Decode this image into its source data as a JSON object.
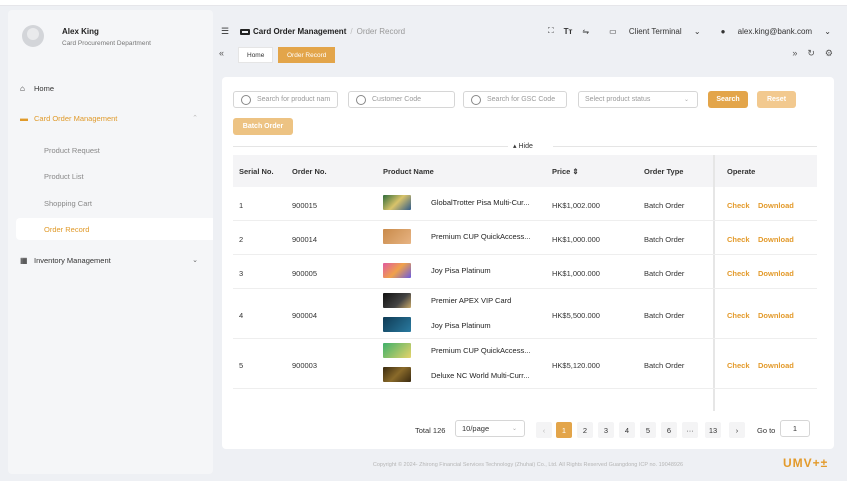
{
  "user": {
    "name": "Alex King",
    "department": "Card Procurement Department"
  },
  "sidebar": {
    "home": "Home",
    "card_order": "Card Order Management",
    "sub_items": [
      "Product Request",
      "Product List",
      "Shopping Cart",
      "Order Record"
    ],
    "inventory": "Inventory Management"
  },
  "header": {
    "breadcrumb_parent": "Card Order Management",
    "breadcrumb_sep": "/",
    "breadcrumb_current": "Order Record",
    "text_size_icon": "Tт",
    "client_terminal": "Client Terminal",
    "email": "alex.king@bank.com"
  },
  "tabs": {
    "home": "Home",
    "order_record": "Order Record"
  },
  "filters": {
    "product_name_placeholder": "Search for product nam",
    "customer_code_placeholder": "Customer Code",
    "gsc_code_placeholder": "Search for GSC Code",
    "status_placeholder": "Select product status",
    "search": "Search",
    "reset": "Reset",
    "batch_order": "Batch Order",
    "hide": "▴ Hide"
  },
  "table": {
    "columns": [
      "Serial No.",
      "Order No.",
      "Product Name",
      "Price ⇕",
      "Order Type",
      "Operate"
    ],
    "rows": [
      {
        "serial": "1",
        "order_no": "900015",
        "products": [
          "GlobalTrotter Pisa Multi-Cur..."
        ],
        "price": "HK$1,002.000",
        "type": "Batch Order"
      },
      {
        "serial": "2",
        "order_no": "900014",
        "products": [
          "Premium CUP QuickAccess..."
        ],
        "price": "HK$1,000.000",
        "type": "Batch Order"
      },
      {
        "serial": "3",
        "order_no": "900005",
        "products": [
          "Joy Pisa Platinum"
        ],
        "price": "HK$1,000.000",
        "type": "Batch Order"
      },
      {
        "serial": "4",
        "order_no": "900004",
        "products": [
          "Premier APEX VIP Card",
          "Joy Pisa Platinum"
        ],
        "price": "HK$5,500.000",
        "type": "Batch Order"
      },
      {
        "serial": "5",
        "order_no": "900003",
        "products": [
          "Premium CUP QuickAccess...",
          "Deluxe NC World  Multi-Curr..."
        ],
        "price": "HK$5,120.000",
        "type": "Batch Order"
      }
    ],
    "check": "Check",
    "download": "Download"
  },
  "pagination": {
    "total": "Total 126",
    "page_size": "10/page",
    "prev": "‹",
    "pages": [
      "1",
      "2",
      "3",
      "4",
      "5",
      "6",
      "···",
      "13"
    ],
    "next": "›",
    "goto_label": "Go to",
    "goto_value": "1"
  },
  "footer": {
    "copyright": "Copyright © 2024- Zhirong Financial Services Technology (Zhuhai) Co., Ltd. All Rights Reserved  Guangdong ICP no. 19048926",
    "logo": "UMV+±"
  },
  "colors": {
    "accent": "#e3a54a",
    "link": "#e39a2a",
    "background": "#eef0f4"
  }
}
